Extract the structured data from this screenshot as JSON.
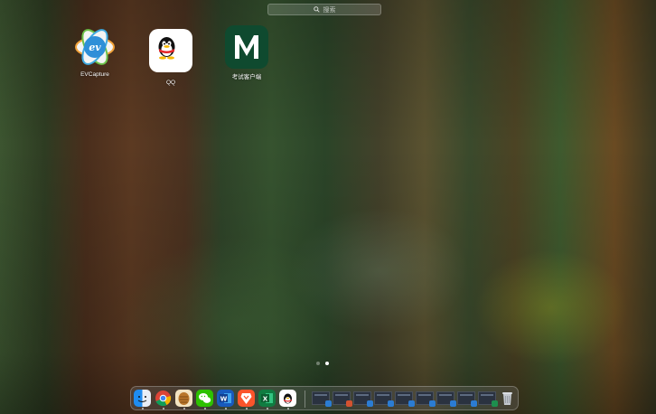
{
  "search": {
    "placeholder": "搜索"
  },
  "apps": [
    {
      "name": "EVCapture"
    },
    {
      "name": "QQ"
    },
    {
      "name": "考试客户端"
    }
  ],
  "pages": {
    "count": 2,
    "current": 2
  },
  "dock": {
    "apps": [
      "finder-icon",
      "chrome-icon",
      "pinecone-icon",
      "wechat-icon",
      "word-icon",
      "brave-icon",
      "excel-icon",
      "qq-icon"
    ],
    "minimized": [
      "word-window",
      "powerpoint-window",
      "word-window",
      "word-window",
      "word-window",
      "word-window",
      "word-window",
      "word-window",
      "excel-window"
    ],
    "trash": "trash-icon"
  },
  "colors": {
    "accent": "#ffffff"
  }
}
